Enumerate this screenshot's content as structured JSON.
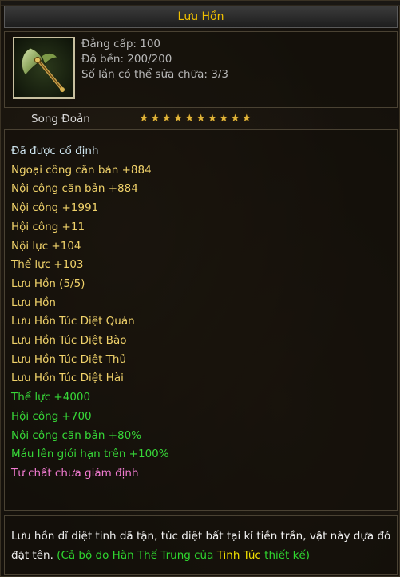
{
  "item": {
    "title": "Lưu Hồn",
    "level": "Đẳng cấp: 100",
    "durability": "Độ bền: 200/200",
    "repairs": "Số lần có thể sửa chữa: 3/3",
    "weapon_name": "Song Đoản",
    "stars": [
      "★",
      "★",
      "★",
      "★",
      "★",
      "★",
      "★",
      "★",
      "★",
      "★"
    ],
    "icon": "axe-weapon-icon"
  },
  "attributes": [
    {
      "text": "Đã được cố định",
      "color": "#cfe6f0"
    },
    {
      "text": "Ngoại công căn bản +884",
      "color": "#f0d26a"
    },
    {
      "text": "Nội công căn bản +884",
      "color": "#f0d26a"
    },
    {
      "text": "Nội công +1991",
      "color": "#f0d26a"
    },
    {
      "text": "Hội công +11",
      "color": "#f0d26a"
    },
    {
      "text": "Nội lực +104",
      "color": "#f0d26a"
    },
    {
      "text": "Thể lực +103",
      "color": "#f0d26a"
    },
    {
      "text": "Lưu Hồn (5/5)",
      "color": "#f0d26a"
    },
    {
      "text": "Lưu Hồn",
      "color": "#f0d26a"
    },
    {
      "text": "Lưu Hồn Túc Diệt Quán",
      "color": "#f0d26a"
    },
    {
      "text": "Lưu Hồn Túc Diệt Bào",
      "color": "#f0d26a"
    },
    {
      "text": "Lưu Hồn Túc Diệt Thủ",
      "color": "#f0d26a"
    },
    {
      "text": "Lưu Hồn Túc Diệt Hài",
      "color": "#f0d26a"
    },
    {
      "text": "Thể lực +4000",
      "color": "#37d838"
    },
    {
      "text": "Hội công +700",
      "color": "#37d838"
    },
    {
      "text": "Nội công căn bản +80%",
      "color": "#37d838"
    },
    {
      "text": "Máu lên giới hạn trên +100%",
      "color": "#37d838"
    },
    {
      "text": "Tư chất chưa giám định",
      "color": "#f07ad0"
    }
  ],
  "description": {
    "text": "Lưu hồn dĩ diệt tinh dã tận, túc diệt bất tại kí tiền trần, vật này dựa đó đặt tên.",
    "credit_prefix": "(Cả bộ do Hàn Thế Trung của",
    "credit_org": "Tinh Túc",
    "credit_suffix": "thiết kế)"
  },
  "colors": {
    "title": "#f0c000",
    "stars": "#e0b43a",
    "credit_green": "#2fd62f",
    "credit_yellow": "#f0e000"
  }
}
